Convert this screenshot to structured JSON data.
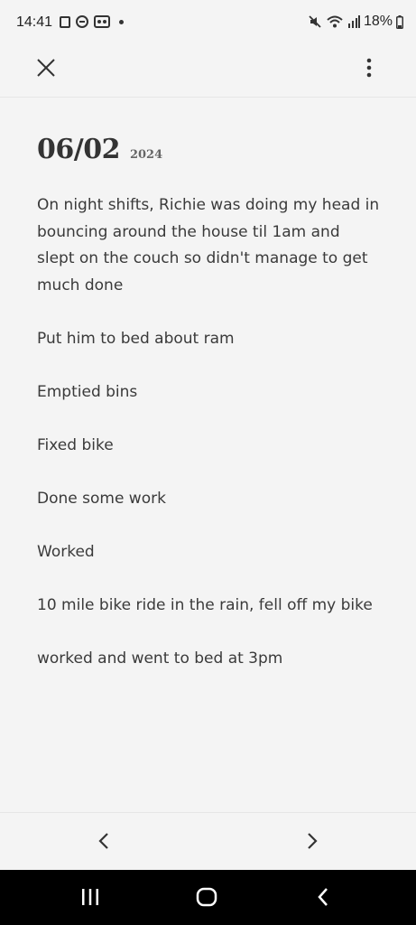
{
  "status_bar": {
    "time": "14:41",
    "battery": "18%",
    "left_icons": [
      "gallery-icon",
      "do-not-disturb-icon",
      "voicemail-icon",
      "notification-dot"
    ],
    "right_icons": [
      "mute-icon",
      "wifi-icon",
      "signal-icon",
      "battery-icon"
    ]
  },
  "toolbar": {
    "close_icon": "close-icon",
    "more_icon": "more-vert-icon"
  },
  "entry": {
    "date": "06/02",
    "year": "2024",
    "paragraphs": [
      "On night shifts, Richie was doing my head in bouncing around the house til 1am and slept on the couch so didn't manage to get much done",
      "Put him to bed about ram",
      "Emptied bins",
      "Fixed bike",
      "Done some work",
      "Worked",
      "10 mile bike ride in the rain, fell off my bike",
      "worked and went to bed at 3pm"
    ]
  },
  "bottom_nav": {
    "prev_icon": "chevron-left-icon",
    "next_icon": "chevron-right-icon"
  },
  "system_nav": {
    "recents_icon": "recents-icon",
    "home_icon": "home-icon",
    "back_icon": "back-icon"
  }
}
